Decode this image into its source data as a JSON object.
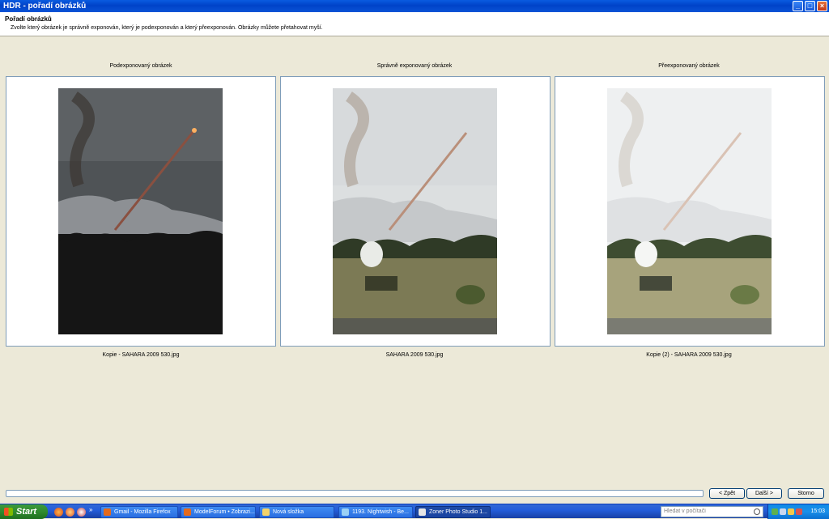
{
  "window": {
    "title": "HDR - pořadí obrázků"
  },
  "header": {
    "title": "Pořadí obrázků",
    "instruction": "Zvolte který obrázek je správně exponován, který je podexponován a který přeexponován. Obrázky můžete přetahovat myší."
  },
  "columns": [
    {
      "label": "Podexponovaný obrázek",
      "file": "Kopie - SAHARA 2009 530.jpg"
    },
    {
      "label": "Správně exponovaný obrázek",
      "file": "SAHARA 2009 530.jpg"
    },
    {
      "label": "Přeexponovaný obrázek",
      "file": "Kopie (2) - SAHARA 2009 530.jpg"
    }
  ],
  "progress": 0,
  "buttons": {
    "back": "< Zpět",
    "next": "Další >",
    "cancel": "Storno"
  },
  "taskbar": {
    "start": "Start",
    "tasks": [
      "Gmail - Mozilla Firefox",
      "ModelForum • Zobrazi...",
      "Nová složka",
      "1193. Nightwish - Be...",
      "Zoner Photo Studio 1..."
    ],
    "search_placeholder": "Hledat v počítači",
    "clock": "15:03",
    "quicklaunch_more": "»"
  }
}
